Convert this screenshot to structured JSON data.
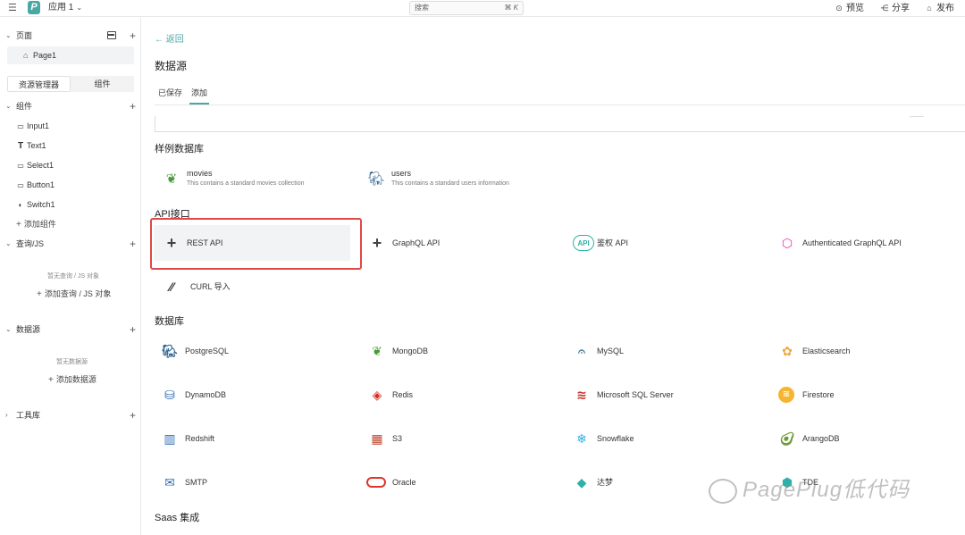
{
  "topbar": {
    "app_name": "应用 1",
    "search_placeholder": "搜索",
    "search_shortcut": "⌘ K",
    "preview": "预览",
    "share": "分享",
    "publish": "发布"
  },
  "sidebar": {
    "pages_label": "页面",
    "page_item": "Page1",
    "tab_explorer": "资源管理器",
    "tab_widgets": "组件",
    "components_label": "组件",
    "components": [
      {
        "icon": "input-icon",
        "label": "Input1"
      },
      {
        "icon": "text-icon",
        "label": "Text1"
      },
      {
        "icon": "select-icon",
        "label": "Select1"
      },
      {
        "icon": "button-icon",
        "label": "Button1"
      },
      {
        "icon": "switch-icon",
        "label": "Switch1"
      }
    ],
    "add_component": "添加组件",
    "queries_label": "查询/JS",
    "queries_empty": "暂无查询 / JS 对象",
    "add_query": "添加查询 / JS 对象",
    "datasources_label": "数据源",
    "datasources_empty": "暂无数据源",
    "add_datasource": "添加数据源",
    "libraries_label": "工具库"
  },
  "main": {
    "back": "返回",
    "title": "数据源",
    "tab_saved": "已保存",
    "tab_add": "添加",
    "sample_title": "样例数据库",
    "samples": [
      {
        "name": "movies",
        "desc": "This contains a standard movies collection",
        "icon": "mongodb-leaf-icon"
      },
      {
        "name": "users",
        "desc": "This contains a standard users information",
        "icon": "postgres-elephant-icon"
      }
    ],
    "api_title": "API接口",
    "apis": [
      {
        "name": "REST API",
        "icon": "plus-icon"
      },
      {
        "name": "GraphQL API",
        "icon": "plus-icon"
      },
      {
        "name": "鉴权 API",
        "icon": "auth-api-cloud-icon"
      },
      {
        "name": "Authenticated GraphQL API",
        "icon": "graphql-icon"
      },
      {
        "name": "CURL 导入",
        "icon": "curl-icon"
      }
    ],
    "db_title": "数据库",
    "databases": [
      {
        "name": "PostgreSQL",
        "icon": "postgresql-icon",
        "color": "#336791"
      },
      {
        "name": "MongoDB",
        "icon": "mongodb-icon",
        "color": "#4a9a3c"
      },
      {
        "name": "MySQL",
        "icon": "mysql-icon",
        "color": "#4479a1"
      },
      {
        "name": "Elasticsearch",
        "icon": "elasticsearch-icon",
        "color": "#f0a63a"
      },
      {
        "name": "DynamoDB",
        "icon": "dynamodb-icon",
        "color": "#2f6db5"
      },
      {
        "name": "Redis",
        "icon": "redis-icon",
        "color": "#d82c20"
      },
      {
        "name": "Microsoft SQL Server",
        "icon": "mssql-icon",
        "color": "#c8312a"
      },
      {
        "name": "Firestore",
        "icon": "firestore-icon",
        "color": "#f6b531"
      },
      {
        "name": "Redshift",
        "icon": "redshift-icon",
        "color": "#2f6db5"
      },
      {
        "name": "S3",
        "icon": "s3-icon",
        "color": "#c0452b"
      },
      {
        "name": "Snowflake",
        "icon": "snowflake-icon",
        "color": "#29b5e8"
      },
      {
        "name": "ArangoDB",
        "icon": "arangodb-icon",
        "color": "#6f9a3a"
      },
      {
        "name": "SMTP",
        "icon": "smtp-icon",
        "color": "#2f6db5"
      },
      {
        "name": "Oracle",
        "icon": "oracle-icon",
        "color": "#e0342a"
      },
      {
        "name": "达梦",
        "icon": "dameng-icon",
        "color": "#2fb0a8"
      },
      {
        "name": "TDE",
        "icon": "tde-icon",
        "color": "#2fb0a8"
      }
    ],
    "saas_title": "Saas 集成"
  },
  "watermark": "PagePlug低代码",
  "accent": "#4aa8a4",
  "highlight_color": "#e04848"
}
